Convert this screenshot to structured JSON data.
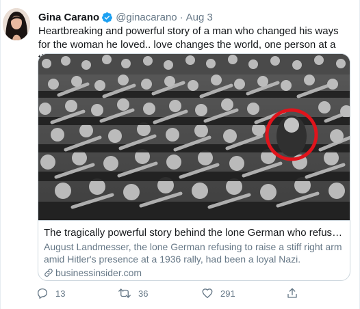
{
  "tweet": {
    "author": {
      "name": "Gina Carano",
      "handle": "@ginacarano",
      "verified": true,
      "avatar_icon": "avatar-photo"
    },
    "separator": "·",
    "date": "Aug 3",
    "text": "Heartbreaking and powerful story of a man who changed his ways for the woman he loved.. love changes the world, one person at a time.",
    "text_emoji": "red-heart-emoji",
    "card": {
      "image_description_icon": "crowd-photo",
      "title": "The tragically powerful story behind the lone German who refused to gi...",
      "description": "August Landmesser, the lone German refusing to raise a stiff right arm amid Hitler's presence at a 1936 rally, had been a loyal Nazi.",
      "domain": "businessinsider.com",
      "highlight_color": "#e0141c"
    },
    "actions": {
      "reply_count": "13",
      "retweet_count": "36",
      "like_count": "291"
    }
  },
  "colors": {
    "verified_blue": "#1da1f2",
    "secondary_text": "#657786",
    "border": "#ccd6dd",
    "heart_red": "#e0245e"
  }
}
